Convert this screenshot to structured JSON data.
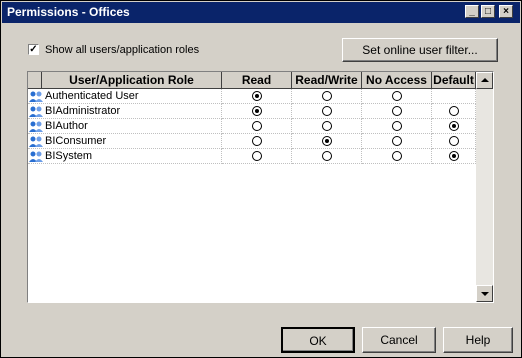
{
  "window": {
    "title": "Permissions - Offices",
    "title_bar_color": "#0a246a",
    "controls": [
      "minimize-icon",
      "maximize-icon",
      "close-icon"
    ]
  },
  "options": {
    "show_all_label": "Show all users/application roles",
    "show_all_checked": true,
    "filter_button": "Set online user filter..."
  },
  "grid": {
    "columns": [
      "User/Application Role",
      "Read",
      "Read/Write",
      "No Access",
      "Default"
    ],
    "rows": [
      {
        "name": "Authenticated User",
        "icon": "user-group-icon",
        "read": true,
        "read_write": false,
        "no_access": false,
        "default": null
      },
      {
        "name": "BIAdministrator",
        "icon": "user-group-icon",
        "read": true,
        "read_write": false,
        "no_access": false,
        "default": false
      },
      {
        "name": "BIAuthor",
        "icon": "user-group-icon",
        "read": false,
        "read_write": false,
        "no_access": false,
        "default": true
      },
      {
        "name": "BIConsumer",
        "icon": "user-group-icon",
        "read": false,
        "read_write": true,
        "no_access": false,
        "default": false
      },
      {
        "name": "BISystem",
        "icon": "user-group-icon",
        "read": false,
        "read_write": false,
        "no_access": false,
        "default": true
      }
    ]
  },
  "footer": {
    "ok": "OK",
    "cancel": "Cancel",
    "help": "Help"
  }
}
